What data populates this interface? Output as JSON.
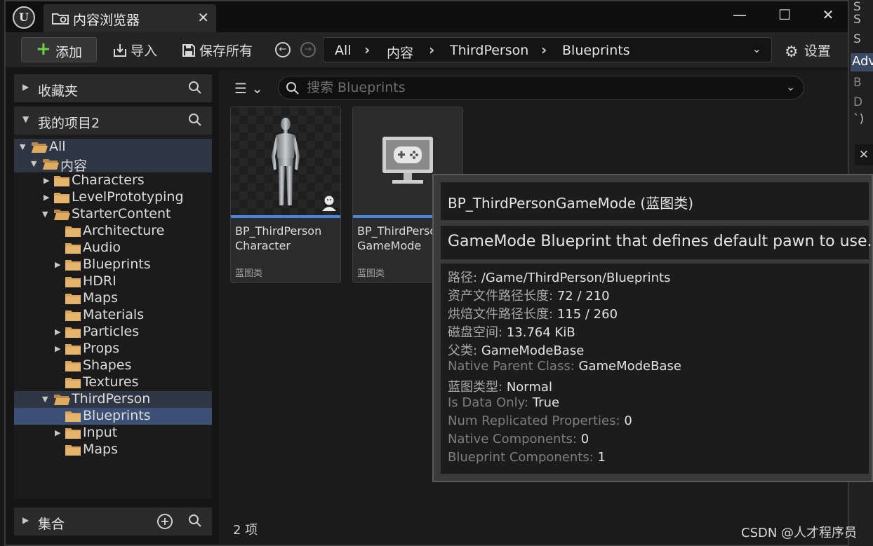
{
  "window": {
    "logo": "U",
    "tab_title": "内容浏览器",
    "tab_close": "✕",
    "minimize": "—",
    "maximize": "☐",
    "close": "✕"
  },
  "toolbar": {
    "add_label": "添加",
    "import_label": "导入",
    "save_all_label": "保存所有",
    "settings_label": "设置",
    "breadcrumb": [
      "All",
      "内容",
      "ThirdPerson",
      "Blueprints"
    ]
  },
  "left": {
    "favorites_title": "收藏夹",
    "project_title": "我的项目2",
    "collections_title": "集合",
    "tree": [
      {
        "label": "All",
        "level": 0,
        "expanded": true
      },
      {
        "label": "内容",
        "level": 1,
        "expanded": true
      },
      {
        "label": "Characters",
        "level": 2,
        "expanded": false,
        "has_children": true
      },
      {
        "label": "LevelPrototyping",
        "level": 2,
        "expanded": false,
        "has_children": true
      },
      {
        "label": "StarterContent",
        "level": 2,
        "expanded": true,
        "has_children": true
      },
      {
        "label": "Architecture",
        "level": 3
      },
      {
        "label": "Audio",
        "level": 3
      },
      {
        "label": "Blueprints",
        "level": 3,
        "has_children": true
      },
      {
        "label": "HDRI",
        "level": 3
      },
      {
        "label": "Maps",
        "level": 3
      },
      {
        "label": "Materials",
        "level": 3
      },
      {
        "label": "Particles",
        "level": 3,
        "has_children": true
      },
      {
        "label": "Props",
        "level": 3,
        "has_children": true
      },
      {
        "label": "Shapes",
        "level": 3
      },
      {
        "label": "Textures",
        "level": 3
      },
      {
        "label": "ThirdPerson",
        "level": 2,
        "expanded": true,
        "has_children": true
      },
      {
        "label": "Blueprints",
        "level": 3,
        "selected": true
      },
      {
        "label": "Input",
        "level": 3,
        "has_children": true
      },
      {
        "label": "Maps",
        "level": 3
      }
    ]
  },
  "content": {
    "search_placeholder": "搜索 Blueprints",
    "item_count": "2 项",
    "assets": [
      {
        "name_line1": "BP_ThirdPerson",
        "name_line2": "Character",
        "type": "蓝图类",
        "icon": "mannequin-thumbnail"
      },
      {
        "name_line1": "BP_ThirdPerso",
        "name_line2": "GameMode",
        "type": "蓝图类",
        "icon": "gamemode-monitor-icon"
      }
    ]
  },
  "tooltip": {
    "title": "BP_ThirdPersonGameMode (蓝图类)",
    "description": "GameMode Blueprint that defines default pawn to use.",
    "rows": [
      {
        "key": "路径:",
        "value": "/Game/ThirdPerson/Blueprints",
        "bright": true
      },
      {
        "key": "资产文件路径长度:",
        "value": "72 / 210",
        "bright": true
      },
      {
        "key": "烘焙文件路径长度:",
        "value": "115 / 260",
        "bright": true
      },
      {
        "key": "磁盘空间:",
        "value": "13.764 KiB",
        "bright": true
      },
      {
        "key": "父类:",
        "value": "GameModeBase",
        "bright": true
      },
      {
        "key": "Native Parent Class:",
        "value": "GameModeBase",
        "bright": false
      },
      {
        "key": "蓝图类型:",
        "value": "Normal",
        "bright": true
      },
      {
        "key": "Is Data Only:",
        "value": "True",
        "bright": false
      },
      {
        "key": "Num Replicated Properties:",
        "value": "0",
        "bright": false
      },
      {
        "key": "Native Components:",
        "value": "0",
        "bright": false
      },
      {
        "key": "Blueprint Components:",
        "value": "1",
        "bright": false
      }
    ]
  },
  "right_strip": {
    "items": [
      "S",
      "S",
      "S"
    ],
    "adv_label": "Adv",
    "lower_items": [
      "B",
      "D",
      "`)"
    ],
    "close": "✕"
  },
  "watermark": "CSDN @人才程序员",
  "colors": {
    "accent_blue": "#4a86e0",
    "selection": "#3c5075",
    "folder": "#d9a35a",
    "add_green": "#6bd04a"
  }
}
